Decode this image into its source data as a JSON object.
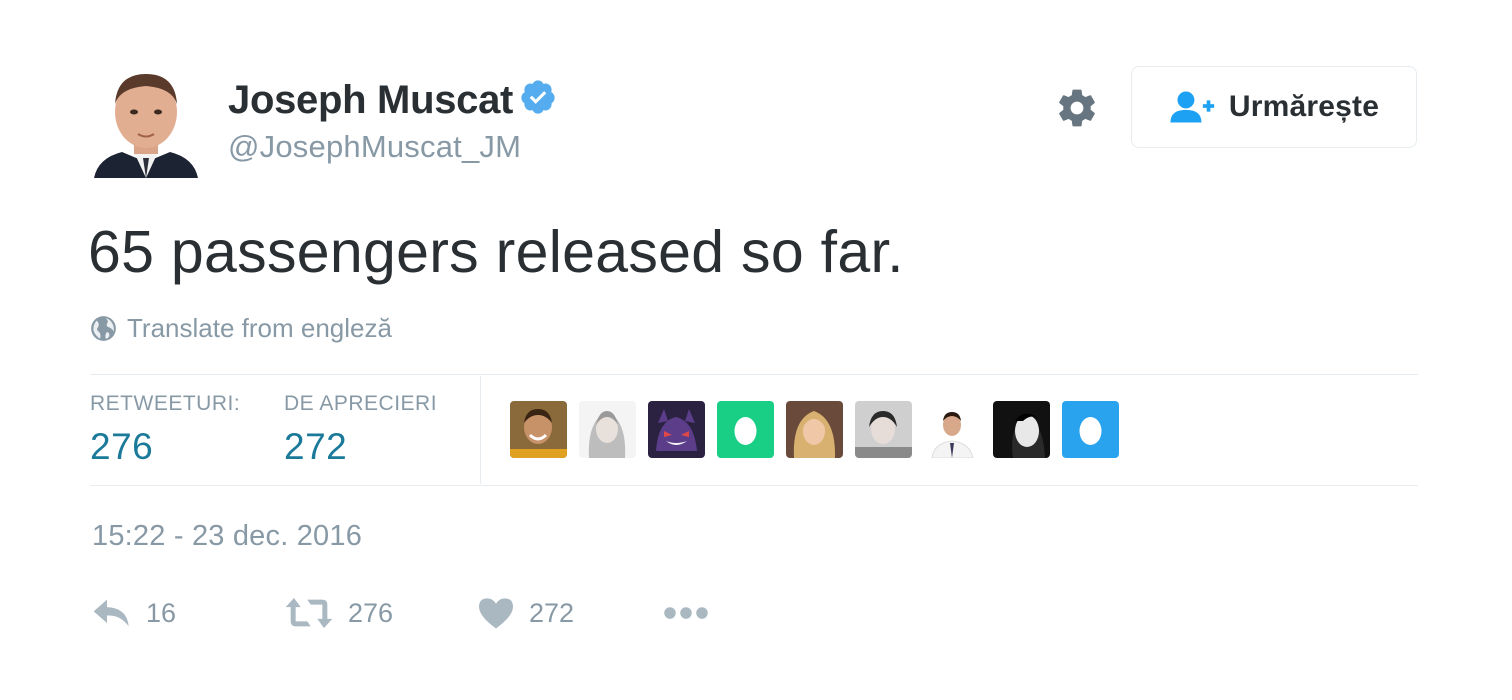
{
  "user": {
    "name": "Joseph Muscat",
    "handle": "@JosephMuscat_JM",
    "verified": true
  },
  "header": {
    "settings_icon": "gear-icon",
    "follow_label": "Urmărește",
    "follow_icon": "add-person-icon"
  },
  "tweet": {
    "text": "65 passengers released so far.",
    "translate_label": "Translate from engleză",
    "timestamp": "15:22 - 23 dec. 2016"
  },
  "stats": {
    "retweets_label": "RETWEETURI:",
    "retweets_value": "276",
    "likes_label": "DE APRECIERI",
    "likes_value": "272"
  },
  "actions": {
    "reply_count": "16",
    "retweet_count": "276",
    "like_count": "272"
  },
  "colors": {
    "accent": "#1da1f2",
    "stat_value": "#1b7a9a",
    "muted_text": "#8899a6",
    "body_text": "#292f33",
    "egg_green": "#19cf86"
  }
}
